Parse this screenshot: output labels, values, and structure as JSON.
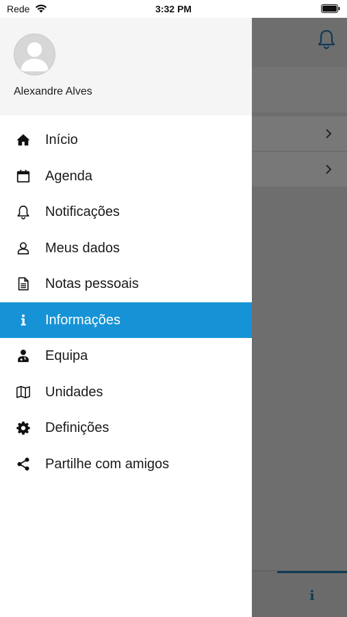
{
  "status_bar": {
    "carrier": "Rede",
    "time": "3:32 PM"
  },
  "drawer": {
    "user_name": "Alexandre Alves",
    "menu": [
      {
        "label": "Início",
        "icon": "home-icon",
        "active": false
      },
      {
        "label": "Agenda",
        "icon": "calendar-icon",
        "active": false
      },
      {
        "label": "Notificações",
        "icon": "bell-icon",
        "active": false
      },
      {
        "label": "Meus dados",
        "icon": "user-icon",
        "active": false
      },
      {
        "label": "Notas pessoais",
        "icon": "document-icon",
        "active": false
      },
      {
        "label": "Informações",
        "icon": "info-icon",
        "active": true
      },
      {
        "label": "Equipa",
        "icon": "doctor-icon",
        "active": false
      },
      {
        "label": "Unidades",
        "icon": "map-icon",
        "active": false
      },
      {
        "label": "Definições",
        "icon": "gear-icon",
        "active": false
      },
      {
        "label": "Partilhe com amigos",
        "icon": "share-icon",
        "active": false
      }
    ]
  },
  "background_app": {
    "header_icon": "bell-icon",
    "rows": [
      {
        "icon": "chevron-right-icon"
      },
      {
        "icon": "chevron-right-icon"
      }
    ],
    "tabbar_active_icon": "info-icon"
  },
  "colors": {
    "accent": "#1693d6",
    "overlay": "#6e6e6e",
    "tab_dark": "#0e3a55"
  }
}
